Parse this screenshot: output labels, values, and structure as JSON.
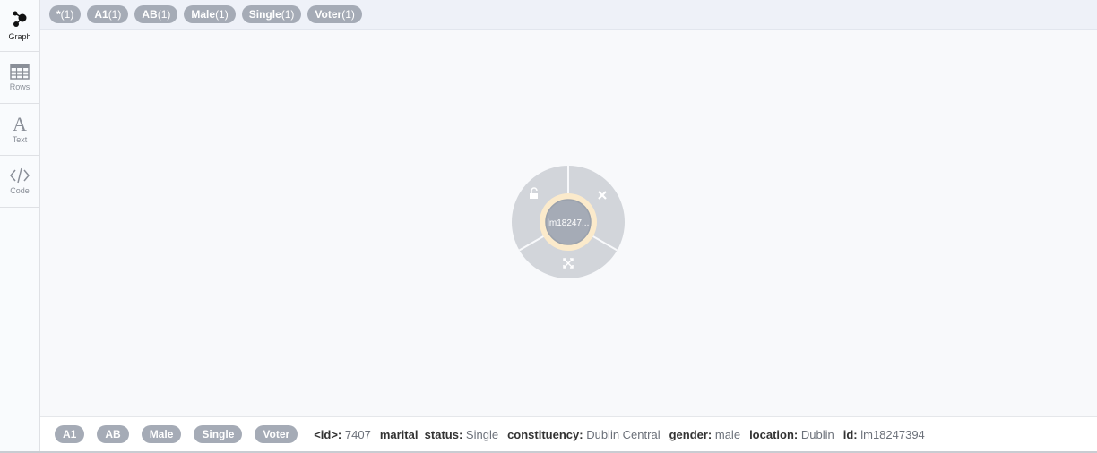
{
  "sidebar": {
    "items": [
      {
        "label": "Graph",
        "icon": "graph-icon",
        "active": true
      },
      {
        "label": "Rows",
        "icon": "table-icon",
        "active": false
      },
      {
        "label": "Text",
        "icon": "text-icon",
        "active": false
      },
      {
        "label": "Code",
        "icon": "code-icon",
        "active": false
      }
    ]
  },
  "topbar": {
    "labels": [
      {
        "name": "*",
        "count": "(1)"
      },
      {
        "name": "A1",
        "count": "(1)"
      },
      {
        "name": "AB",
        "count": "(1)"
      },
      {
        "name": "Male",
        "count": "(1)"
      },
      {
        "name": "Single",
        "count": "(1)"
      },
      {
        "name": "Voter",
        "count": "(1)"
      }
    ]
  },
  "graph": {
    "node": {
      "caption": "lm18247...",
      "fill_color": "#a5abb6",
      "ring_color": "#fbeacb",
      "menu_color": "#d2d5da",
      "menu_icons": [
        "unlock-icon",
        "close-icon",
        "expand-icon"
      ]
    }
  },
  "details": {
    "labels": [
      "A1",
      "AB",
      "Male",
      "Single",
      "Voter"
    ],
    "properties": [
      {
        "key": "<id>:",
        "value": "7407"
      },
      {
        "key": "marital_status:",
        "value": "Single"
      },
      {
        "key": "constituency:",
        "value": "Dublin Central"
      },
      {
        "key": "gender:",
        "value": "male"
      },
      {
        "key": "location:",
        "value": "Dublin"
      },
      {
        "key": "id:",
        "value": "lm18247394"
      }
    ]
  }
}
